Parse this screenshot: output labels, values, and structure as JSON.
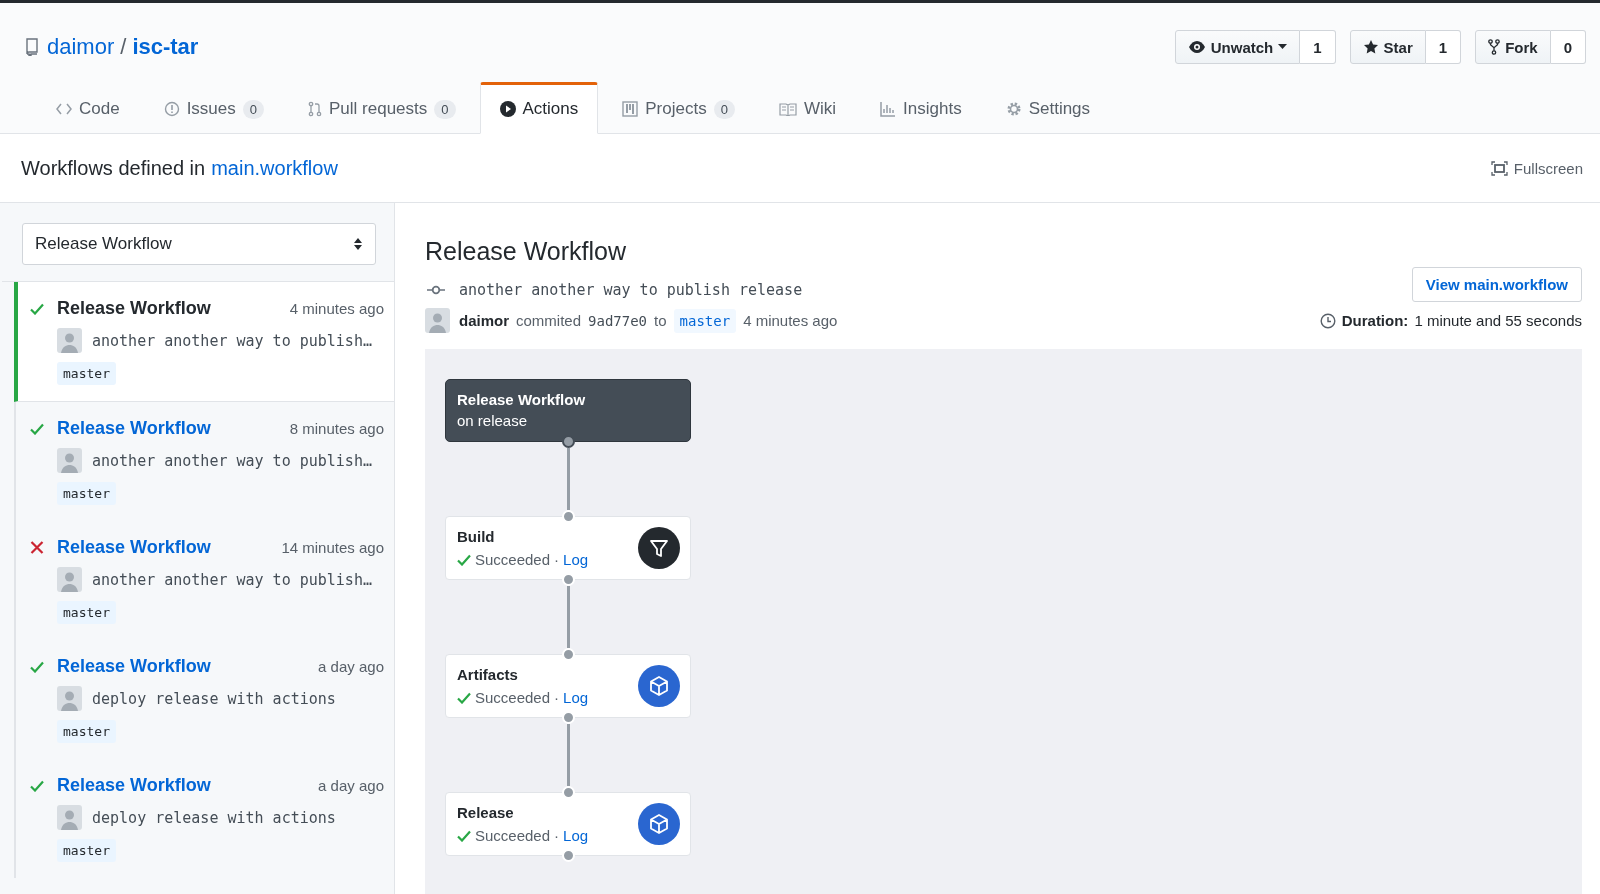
{
  "repo": {
    "owner": "daimor",
    "separator": "/",
    "name": "isc-tar"
  },
  "social": [
    {
      "kind": "watch",
      "label": "Unwatch",
      "count": "1"
    },
    {
      "kind": "star",
      "label": "Star",
      "count": "1"
    },
    {
      "kind": "fork",
      "label": "Fork",
      "count": "0"
    }
  ],
  "tabs": [
    {
      "kind": "code",
      "label": "Code",
      "selected": false
    },
    {
      "kind": "issues",
      "label": "Issues",
      "count": "0",
      "selected": false
    },
    {
      "kind": "pulls",
      "label": "Pull requests",
      "count": "0",
      "selected": false
    },
    {
      "kind": "actions",
      "label": "Actions",
      "selected": true
    },
    {
      "kind": "projects",
      "label": "Projects",
      "count": "0",
      "selected": false
    },
    {
      "kind": "wiki",
      "label": "Wiki",
      "selected": false
    },
    {
      "kind": "insights",
      "label": "Insights",
      "selected": false
    },
    {
      "kind": "settings",
      "label": "Settings",
      "selected": false
    }
  ],
  "workflows_bar": {
    "text": "Workflows defined in",
    "link": "main.workflow",
    "fullscreen": "Fullscreen"
  },
  "workflow_select": {
    "value": "Release Workflow"
  },
  "runs": [
    {
      "title": "Release Workflow",
      "time": "4 minutes ago",
      "succeeded": true,
      "selected": true,
      "message": "another another way to publish…",
      "branch": "master"
    },
    {
      "title": "Release Workflow",
      "time": "8 minutes ago",
      "succeeded": true,
      "selected": false,
      "message": "another another way to publish…",
      "branch": "master"
    },
    {
      "title": "Release Workflow",
      "time": "14 minutes ago",
      "succeeded": false,
      "selected": false,
      "message": "another another way to publish…",
      "branch": "master"
    },
    {
      "title": "Release Workflow",
      "time": "a day ago",
      "succeeded": true,
      "selected": false,
      "message": "deploy release with actions",
      "branch": "master"
    },
    {
      "title": "Release Workflow",
      "time": "a day ago",
      "succeeded": true,
      "selected": false,
      "message": "deploy release with actions",
      "branch": "master"
    }
  ],
  "detail": {
    "title": "Release Workflow",
    "view_button": "View main.workflow",
    "commit_message": "another another way to publish release",
    "author": "daimor",
    "verb": "commited",
    "sha": "9ad77e0",
    "to": "to",
    "branch": "master",
    "time": "4 minutes ago",
    "duration_label": "Duration:",
    "duration": "1 minute and 55 seconds"
  },
  "graph": {
    "trigger": {
      "title": "Release Workflow",
      "subtitle": "on release"
    },
    "jobs": [
      {
        "kind": "filter",
        "name": "Build",
        "succeeded": true,
        "status_text": "Succeeded",
        "separator": "·",
        "log": "Log"
      },
      {
        "kind": "box",
        "name": "Artifacts",
        "succeeded": true,
        "status_text": "Succeeded",
        "separator": "·",
        "log": "Log"
      },
      {
        "kind": "box",
        "name": "Release",
        "succeeded": true,
        "status_text": "Succeeded",
        "separator": "·",
        "log": "Log"
      }
    ]
  }
}
